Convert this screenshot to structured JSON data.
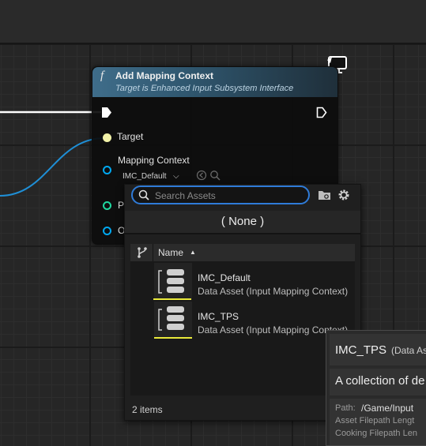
{
  "node": {
    "title": "Add Mapping Context",
    "subtitle": "Target is Enhanced Input Subsystem Interface",
    "func_icon": "f",
    "pins": {
      "target_label": "Target",
      "mapping_context_label": "Mapping Context",
      "mapping_context_value": "IMC_Default",
      "priority_label_partial": "P",
      "options_label_partial": "O"
    }
  },
  "picker": {
    "search_placeholder": "Search Assets",
    "none_label": "( None )",
    "column_name": "Name",
    "sort_indicator": "▲",
    "items": [
      {
        "name": "IMC_Default",
        "type": "Data Asset (Input Mapping Context)"
      },
      {
        "name": "IMC_TPS",
        "type": "Data Asset (Input Mapping Context)"
      }
    ],
    "footer": "2 items"
  },
  "tooltip": {
    "title": "IMC_TPS",
    "title_suffix": "(Data As",
    "description": "A collection of de",
    "path_label": "Path:",
    "path_value": "/Game/Input",
    "line2": "Asset Filepath Lengt",
    "line3": "Cooking Filepath Len"
  },
  "colors": {
    "accent_blue": "#2f7bd8",
    "exec_white": "#ffffff",
    "wire_blue": "#1f8fd6",
    "object_pin": "#00a8f0",
    "int_pin": "#1fd8a0",
    "highlight_yellow": "#e9e93a"
  },
  "icons": [
    "function-icon",
    "exec-pin-icon",
    "monitor-icon",
    "search-icon",
    "folder-icon",
    "gear-icon",
    "branch-filter-icon",
    "asset-thumbnail-icon",
    "browse-icon",
    "use-selected-icon",
    "dropdown-arrow-icon"
  ]
}
